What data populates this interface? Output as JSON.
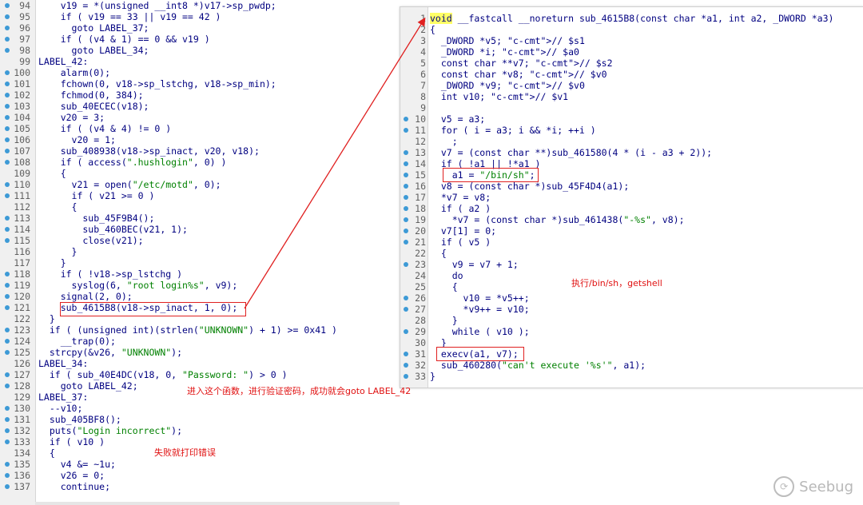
{
  "left_panel": {
    "lines": [
      {
        "n": "94",
        "dot": true,
        "t": "    v19 = *(unsigned __int8 *)v17->sp_pwdp;"
      },
      {
        "n": "95",
        "dot": true,
        "t": "    if ( v19 == 33 || v19 == 42 )"
      },
      {
        "n": "96",
        "dot": true,
        "t": "      goto LABEL_37;"
      },
      {
        "n": "97",
        "dot": true,
        "t": "    if ( (v4 & 1) == 0 && v19 )"
      },
      {
        "n": "98",
        "dot": true,
        "t": "      goto LABEL_34;"
      },
      {
        "n": "99",
        "dot": false,
        "t": "LABEL_42:"
      },
      {
        "n": "100",
        "dot": true,
        "t": "    alarm(0);"
      },
      {
        "n": "101",
        "dot": true,
        "t": "    fchown(0, v18->sp_lstchg, v18->sp_min);"
      },
      {
        "n": "102",
        "dot": true,
        "t": "    fchmod(0, 384);"
      },
      {
        "n": "103",
        "dot": true,
        "t": "    sub_40ECEC(v18);"
      },
      {
        "n": "104",
        "dot": true,
        "t": "    v20 = 3;"
      },
      {
        "n": "105",
        "dot": true,
        "t": "    if ( (v4 & 4) != 0 )"
      },
      {
        "n": "106",
        "dot": true,
        "t": "      v20 = 1;"
      },
      {
        "n": "107",
        "dot": true,
        "t": "    sub_408938(v18->sp_inact, v20, v18);"
      },
      {
        "n": "108",
        "dot": true,
        "t": "    if ( access(\".hushlogin\", 0) )"
      },
      {
        "n": "109",
        "dot": false,
        "t": "    {"
      },
      {
        "n": "110",
        "dot": true,
        "t": "      v21 = open(\"/etc/motd\", 0);"
      },
      {
        "n": "111",
        "dot": true,
        "t": "      if ( v21 >= 0 )"
      },
      {
        "n": "112",
        "dot": false,
        "t": "      {"
      },
      {
        "n": "113",
        "dot": true,
        "t": "        sub_45F9B4();"
      },
      {
        "n": "114",
        "dot": true,
        "t": "        sub_460BEC(v21, 1);"
      },
      {
        "n": "115",
        "dot": true,
        "t": "        close(v21);"
      },
      {
        "n": "116",
        "dot": false,
        "t": "      }"
      },
      {
        "n": "117",
        "dot": false,
        "t": "    }"
      },
      {
        "n": "118",
        "dot": true,
        "t": "    if ( !v18->sp_lstchg )"
      },
      {
        "n": "119",
        "dot": true,
        "t": "      syslog(6, \"root login%s\", v9);"
      },
      {
        "n": "120",
        "dot": true,
        "t": "    signal(2, 0);"
      },
      {
        "n": "121",
        "dot": true,
        "t": "    sub_4615B8(v18->sp_inact, 1, 0);"
      },
      {
        "n": "122",
        "dot": false,
        "t": "  }"
      },
      {
        "n": "123",
        "dot": true,
        "t": "  if ( (unsigned int)(strlen(\"UNKNOWN\") + 1) >= 0x41 )"
      },
      {
        "n": "124",
        "dot": true,
        "t": "    __trap(0);"
      },
      {
        "n": "125",
        "dot": true,
        "t": "  strcpy(&v26, \"UNKNOWN\");"
      },
      {
        "n": "126",
        "dot": false,
        "t": "LABEL_34:"
      },
      {
        "n": "127",
        "dot": true,
        "t": "  if ( sub_40E4DC(v18, 0, \"Password: \") > 0 )"
      },
      {
        "n": "128",
        "dot": true,
        "t": "    goto LABEL_42;"
      },
      {
        "n": "129",
        "dot": false,
        "t": "LABEL_37:"
      },
      {
        "n": "130",
        "dot": true,
        "t": "  --v10;"
      },
      {
        "n": "131",
        "dot": true,
        "t": "  sub_405BF8();"
      },
      {
        "n": "132",
        "dot": true,
        "t": "  puts(\"Login incorrect\");"
      },
      {
        "n": "133",
        "dot": true,
        "t": "  if ( v10 )"
      },
      {
        "n": "134",
        "dot": false,
        "t": "  {"
      },
      {
        "n": "135",
        "dot": true,
        "t": "    v4 &= ~1u;"
      },
      {
        "n": "136",
        "dot": true,
        "t": "    v26 = 0;"
      },
      {
        "n": "137",
        "dot": true,
        "t": "    continue;"
      }
    ]
  },
  "right_panel": {
    "lines": [
      {
        "n": "1",
        "dot": false,
        "t": "void __fastcall __noreturn sub_4615B8(const char *a1, int a2, _DWORD *a3)"
      },
      {
        "n": "2",
        "dot": false,
        "t": "{"
      },
      {
        "n": "3",
        "dot": false,
        "t": "  _DWORD *v5; // $s1"
      },
      {
        "n": "4",
        "dot": false,
        "t": "  _DWORD *i; // $a0"
      },
      {
        "n": "5",
        "dot": false,
        "t": "  const char **v7; // $s2"
      },
      {
        "n": "6",
        "dot": false,
        "t": "  const char *v8; // $v0"
      },
      {
        "n": "7",
        "dot": false,
        "t": "  _DWORD *v9; // $v0"
      },
      {
        "n": "8",
        "dot": false,
        "t": "  int v10; // $v1"
      },
      {
        "n": "9",
        "dot": false,
        "t": ""
      },
      {
        "n": "10",
        "dot": true,
        "t": "  v5 = a3;"
      },
      {
        "n": "11",
        "dot": true,
        "t": "  for ( i = a3; i && *i; ++i )"
      },
      {
        "n": "12",
        "dot": false,
        "t": "    ;"
      },
      {
        "n": "13",
        "dot": true,
        "t": "  v7 = (const char **)sub_461580(4 * (i - a3 + 2));"
      },
      {
        "n": "14",
        "dot": true,
        "t": "  if ( !a1 || !*a1 )"
      },
      {
        "n": "15",
        "dot": true,
        "t": "    a1 = \"/bin/sh\";"
      },
      {
        "n": "16",
        "dot": true,
        "t": "  v8 = (const char *)sub_45F4D4(a1);"
      },
      {
        "n": "17",
        "dot": true,
        "t": "  *v7 = v8;"
      },
      {
        "n": "18",
        "dot": true,
        "t": "  if ( a2 )"
      },
      {
        "n": "19",
        "dot": true,
        "t": "    *v7 = (const char *)sub_461438(\"-%s\", v8);"
      },
      {
        "n": "20",
        "dot": true,
        "t": "  v7[1] = 0;"
      },
      {
        "n": "21",
        "dot": true,
        "t": "  if ( v5 )"
      },
      {
        "n": "22",
        "dot": false,
        "t": "  {"
      },
      {
        "n": "23",
        "dot": true,
        "t": "    v9 = v7 + 1;"
      },
      {
        "n": "24",
        "dot": false,
        "t": "    do"
      },
      {
        "n": "25",
        "dot": false,
        "t": "    {"
      },
      {
        "n": "26",
        "dot": true,
        "t": "      v10 = *v5++;"
      },
      {
        "n": "27",
        "dot": true,
        "t": "      *v9++ = v10;"
      },
      {
        "n": "28",
        "dot": false,
        "t": "    }"
      },
      {
        "n": "29",
        "dot": true,
        "t": "    while ( v10 );"
      },
      {
        "n": "30",
        "dot": false,
        "t": "  }"
      },
      {
        "n": "31",
        "dot": true,
        "t": "  execv(a1, v7);"
      },
      {
        "n": "32",
        "dot": true,
        "t": "  sub_460280(\"can't execute '%s'\", a1);"
      },
      {
        "n": "33",
        "dot": true,
        "t": "}"
      }
    ]
  },
  "annotations": {
    "enter_function": "进入这个函数，进行验证密码，成功就会goto LABEL_42",
    "fail_print": "失败就打印错误",
    "exec_shell": "执行/bin/sh，getshell"
  },
  "watermark": {
    "text": "Seebug",
    "logo_glyph": "⟳"
  },
  "colors": {
    "highlight_box": "#e02020",
    "arrow": "#e02020",
    "annotation_text": "#e01010",
    "breakpoint_dot": "#3d9ad6",
    "string": "#008000",
    "comment": "#007f7f"
  }
}
